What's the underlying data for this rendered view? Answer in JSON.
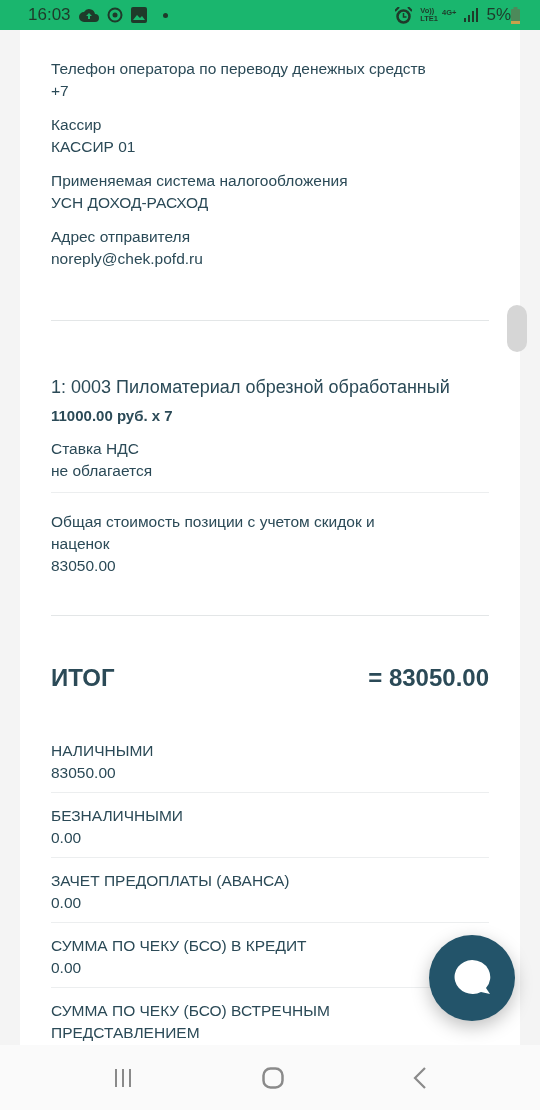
{
  "status_bar": {
    "time": "16:03",
    "battery": "5%",
    "network_top": "Vo))",
    "network_bottom": "LTE1",
    "network_type": "4G+"
  },
  "fields": [
    {
      "label": "Телефон оператора по переводу денежных средств",
      "value": "+7"
    },
    {
      "label": "Кассир",
      "value": "КАССИР 01"
    },
    {
      "label": "Применяемая система налогообложения",
      "value": "УСН ДОХОД-РАСХОД"
    },
    {
      "label": "Адрес отправителя",
      "value": "noreply@chek.pofd.ru"
    }
  ],
  "item": {
    "title": "1: 0003 Пиломатериал обрезной обработанный",
    "price": "11000.00 руб. х 7",
    "details": [
      {
        "label": "Ставка НДС",
        "value": "не облагается"
      },
      {
        "label": "Общая стоимость позиции с учетом скидок и наценок",
        "value": "83050.00"
      }
    ]
  },
  "total": {
    "label": "ИТОГ",
    "value": "= 83050.00"
  },
  "payments": [
    {
      "label": "НАЛИЧНЫМИ",
      "value": "83050.00"
    },
    {
      "label": "БЕЗНАЛИЧНЫМИ",
      "value": "0.00"
    },
    {
      "label": "ЗАЧЕТ ПРЕДОПЛАТЫ (АВАНСА)",
      "value": "0.00"
    },
    {
      "label": "СУММА ПО ЧЕКУ (БСО) В КРЕДИТ",
      "value": "0.00"
    },
    {
      "label": "СУММА ПО ЧЕКУ (БСО) ВСТРЕЧНЫМ ПРЕДСТАВЛЕНИЕМ"
    }
  ]
}
